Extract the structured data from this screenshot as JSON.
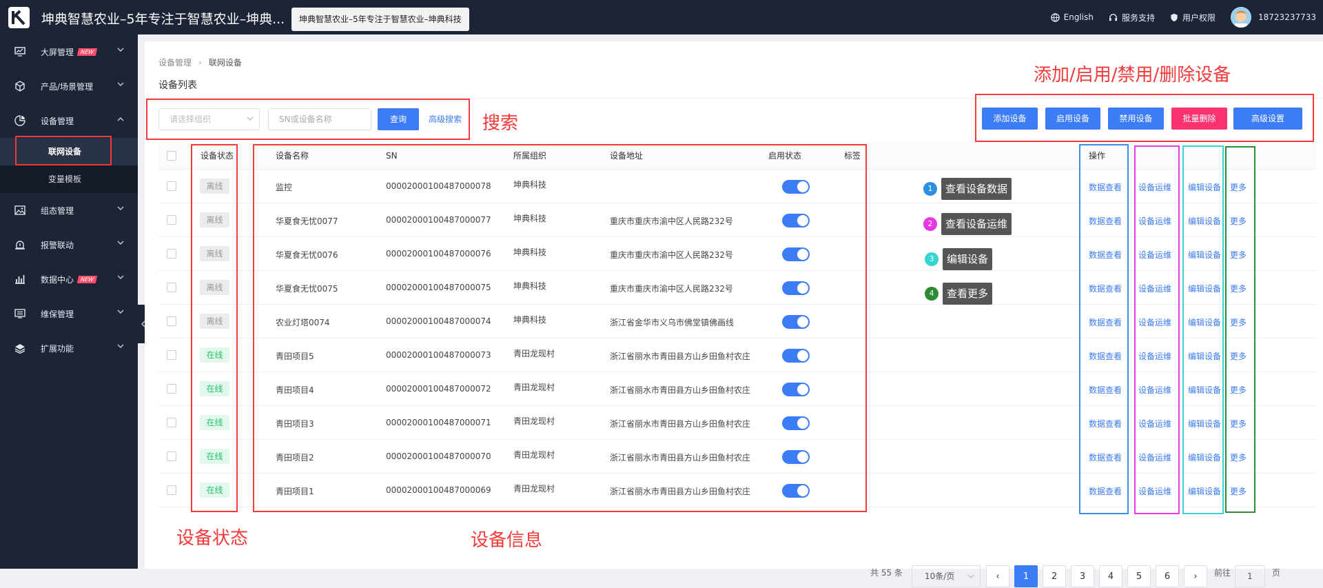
{
  "header": {
    "title": "坤典智慧农业–5年专注于智慧农业–坤典...",
    "tooltip": "坤典智慧农业–5年专注于智慧农业–坤典科技",
    "language": "English",
    "support": "服务支持",
    "permissions": "用户权限",
    "phone": "18723237733"
  },
  "sidebar": {
    "items": [
      {
        "label": "大屏管理",
        "icon": "monitor-icon",
        "badge": "NEW"
      },
      {
        "label": "产品/场景管理",
        "icon": "cube-icon"
      },
      {
        "label": "设备管理",
        "icon": "pie-icon"
      },
      {
        "label": "组态管理",
        "icon": "image-icon"
      },
      {
        "label": "报警联动",
        "icon": "alarm-icon"
      },
      {
        "label": "数据中心",
        "icon": "chart-icon",
        "badge": "NEW"
      },
      {
        "label": "维保管理",
        "icon": "clipboard-icon"
      },
      {
        "label": "扩展功能",
        "icon": "layers-icon"
      }
    ],
    "subitems": [
      "联网设备",
      "变量模板"
    ]
  },
  "breadcrumb": [
    "设备管理",
    "联网设备"
  ],
  "page_title": "设备列表",
  "search": {
    "org_placeholder": "请选择组织",
    "sn_placeholder": "SN或设备名称",
    "query": "查询",
    "advanced": "高级搜索"
  },
  "actions": {
    "add": "添加设备",
    "enable": "启用设备",
    "disable": "禁用设备",
    "batch_delete": "批量删除",
    "advanced_settings": "高级设置"
  },
  "table": {
    "headers": {
      "status": "设备状态",
      "name": "设备名称",
      "sn": "SN",
      "org": "所属组织",
      "address": "设备地址",
      "enabled": "启用状态",
      "tags": "标签",
      "ops": "操作"
    },
    "ops": {
      "view": "数据查看",
      "maint": "设备运维",
      "edit": "编辑设备",
      "more": "更多"
    },
    "rows": [
      {
        "status": "离线",
        "online": false,
        "name": "监控",
        "sn": "00002000100487000078",
        "org": "坤典科技",
        "address": ""
      },
      {
        "status": "离线",
        "online": false,
        "name": "华夏食无忧0077",
        "sn": "00002000100487000077",
        "org": "坤典科技",
        "address": "重庆市重庆市渝中区人民路232号"
      },
      {
        "status": "离线",
        "online": false,
        "name": "华夏食无忧0076",
        "sn": "00002000100487000076",
        "org": "坤典科技",
        "address": "重庆市重庆市渝中区人民路232号"
      },
      {
        "status": "离线",
        "online": false,
        "name": "华夏食无忧0075",
        "sn": "00002000100487000075",
        "org": "坤典科技",
        "address": "重庆市重庆市渝中区人民路232号"
      },
      {
        "status": "离线",
        "online": false,
        "name": "农业灯塔0074",
        "sn": "00002000100487000074",
        "org": "坤典科技",
        "address": "浙江省金华市义乌市佛堂镇佛画线"
      },
      {
        "status": "在线",
        "online": true,
        "name": "青田项目5",
        "sn": "00002000100487000073",
        "org": "青田龙现村",
        "address": "浙江省丽水市青田县方山乡田鱼村农庄"
      },
      {
        "status": "在线",
        "online": true,
        "name": "青田项目4",
        "sn": "00002000100487000072",
        "org": "青田龙现村",
        "address": "浙江省丽水市青田县方山乡田鱼村农庄"
      },
      {
        "status": "在线",
        "online": true,
        "name": "青田项目3",
        "sn": "00002000100487000071",
        "org": "青田龙现村",
        "address": "浙江省丽水市青田县方山乡田鱼村农庄"
      },
      {
        "status": "在线",
        "online": true,
        "name": "青田项目2",
        "sn": "00002000100487000070",
        "org": "青田龙现村",
        "address": "浙江省丽水市青田县方山乡田鱼村农庄"
      },
      {
        "status": "在线",
        "online": true,
        "name": "青田项目1",
        "sn": "00002000100487000069",
        "org": "青田龙现村",
        "address": "浙江省丽水市青田县方山乡田鱼村农庄"
      }
    ]
  },
  "annotations": {
    "actions_label": "添加/启用/禁用/删除设备",
    "search_label": "搜索",
    "status_label": "设备状态",
    "info_label": "设备信息",
    "legend": [
      {
        "num": "1",
        "label": "查看设备数据",
        "color": "#2e8fe0"
      },
      {
        "num": "2",
        "label": "查看设备运维",
        "color": "#e838e2"
      },
      {
        "num": "3",
        "label": "编辑设备",
        "color": "#35d5d2"
      },
      {
        "num": "4",
        "label": "查看更多",
        "color": "#2c8c34"
      }
    ]
  },
  "pagination": {
    "total": "共 55 条",
    "page_size": "10条/页",
    "pages": [
      "1",
      "2",
      "3",
      "4",
      "5",
      "6"
    ],
    "current": "1",
    "goto_prefix": "前往",
    "goto_value": "1",
    "goto_suffix": "页"
  },
  "colors": {
    "accent": "#3c7cf6",
    "danger": "#f8336f",
    "online": "#21c26a",
    "sidebar": "#1c2436"
  }
}
